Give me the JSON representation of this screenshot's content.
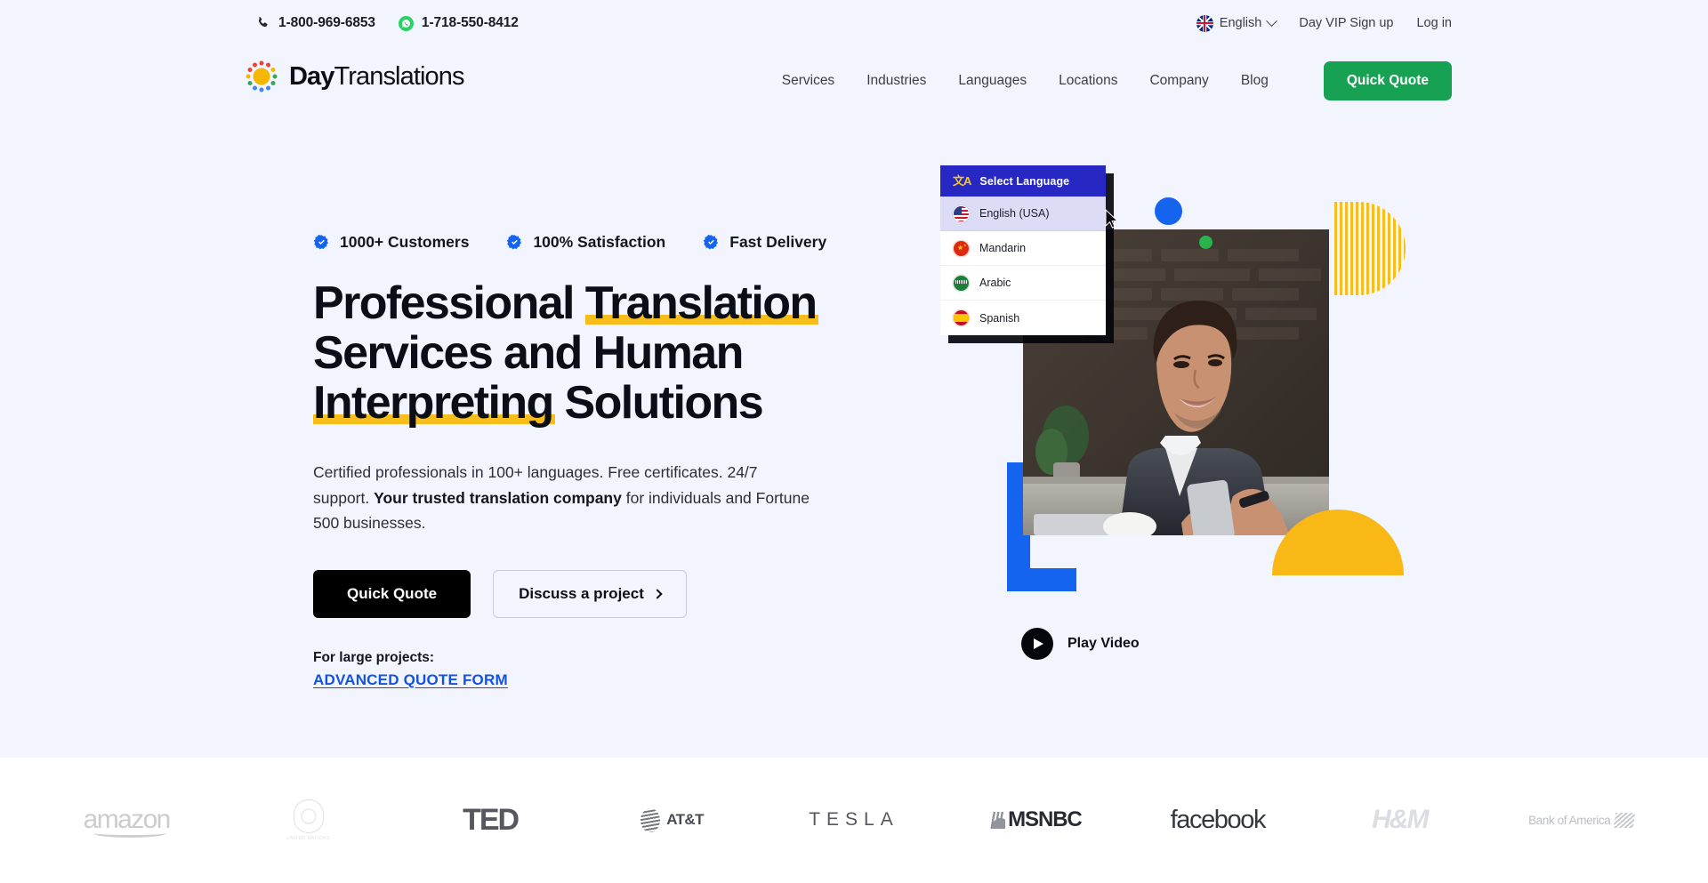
{
  "topbar": {
    "phone_primary": "1-800-969-6853",
    "phone_whatsapp": "1-718-550-8412",
    "language": "English",
    "vip_signup": "Day VIP Sign up",
    "login": "Log in"
  },
  "header": {
    "logo_bold": "Day",
    "logo_regular": "Translations",
    "nav": [
      {
        "label": "Services"
      },
      {
        "label": "Industries"
      },
      {
        "label": "Languages"
      },
      {
        "label": "Locations"
      },
      {
        "label": "Company"
      },
      {
        "label": "Blog"
      }
    ],
    "quote_button": "Quick Quote",
    "quote_button_color": "#17a153"
  },
  "hero": {
    "badges": [
      {
        "label": "1000+ Customers"
      },
      {
        "label": "100% Satisfaction"
      },
      {
        "label": "Fast Delivery"
      }
    ],
    "badge_color": "#1564ef",
    "headline": {
      "line1_plain": "Professional ",
      "line1_highlight": "Translation",
      "line2": "Services and Human",
      "line3_highlight": "Interpreting",
      "line3_plain": " Solutions"
    },
    "highlight_color": "#f7bd1b",
    "paragraph": {
      "part1": "Certified professionals in 100+ languages. Free certificates. 24/7 support. ",
      "bold": "Your trusted translation company",
      "part2": " for individuals and Fortune 500 businesses."
    },
    "primary_cta": "Quick Quote",
    "secondary_cta": "Discuss a project",
    "large_projects_label": "For large projects:",
    "advanced_quote_link": "ADVANCED QUOTE FORM",
    "advanced_quote_color": "#1353e4",
    "play_video_label": "Play Video"
  },
  "language_dropdown": {
    "title": "Select Language",
    "header_color": "#2727c4",
    "options": [
      {
        "label": "English (USA)",
        "flag": "us-flag-icon",
        "selected": true
      },
      {
        "label": "Mandarin",
        "flag": "cn-flag-icon",
        "selected": false
      },
      {
        "label": "Arabic",
        "flag": "sa-flag-icon",
        "selected": false
      },
      {
        "label": "Spanish",
        "flag": "es-flag-icon",
        "selected": false
      }
    ]
  },
  "clients": [
    {
      "name": "amazon"
    },
    {
      "name": "UNITED NATIONS"
    },
    {
      "name": "TED"
    },
    {
      "name": "AT&T"
    },
    {
      "name": "TESLA"
    },
    {
      "name": "MSNBC"
    },
    {
      "name": "facebook"
    },
    {
      "name": "H&M"
    },
    {
      "name": "Bank of America"
    }
  ]
}
